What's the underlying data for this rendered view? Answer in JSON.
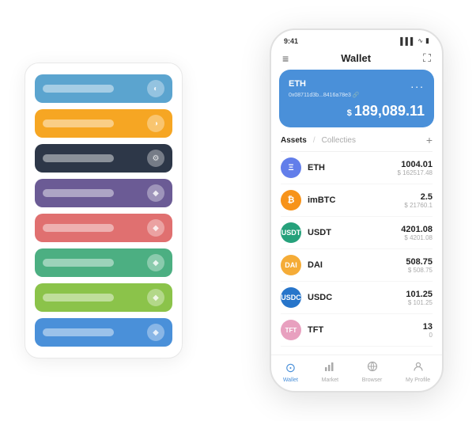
{
  "status_bar": {
    "time": "9:41",
    "signal": "▌▌▌",
    "wifi": "WiFi",
    "battery": "■"
  },
  "nav": {
    "menu_icon": "≡",
    "title": "Wallet",
    "expand_icon": "⛶"
  },
  "eth_card": {
    "label": "ETH",
    "dots": "...",
    "address": "0x08711d3b...8416a78e3 🔗",
    "currency_symbol": "$",
    "amount": "189,089.11"
  },
  "tabs": {
    "active": "Assets",
    "divider": "/",
    "inactive": "Collecties",
    "add_icon": "+"
  },
  "assets": [
    {
      "symbol": "ETH",
      "qty": "1004.01",
      "usd": "$ 162517.48",
      "color": "eth-coin",
      "icon": "Ξ"
    },
    {
      "symbol": "imBTC",
      "qty": "2.5",
      "usd": "$ 21760.1",
      "color": "imbtc-coin",
      "icon": "₿"
    },
    {
      "symbol": "USDT",
      "qty": "4201.08",
      "usd": "$ 4201.08",
      "color": "usdt-coin",
      "icon": "₮"
    },
    {
      "symbol": "DAI",
      "qty": "508.75",
      "usd": "$ 508.75",
      "color": "dai-coin",
      "icon": "◈"
    },
    {
      "symbol": "USDC",
      "qty": "101.25",
      "usd": "$ 101.25",
      "color": "usdc-coin",
      "icon": "⊙"
    },
    {
      "symbol": "TFT",
      "qty": "13",
      "usd": "0",
      "color": "tft-coin",
      "icon": "🌀"
    }
  ],
  "bottom_tabs": [
    {
      "label": "Wallet",
      "active": true,
      "icon": "⊙"
    },
    {
      "label": "Market",
      "active": false,
      "icon": "📊"
    },
    {
      "label": "Browser",
      "active": false,
      "icon": "🌐"
    },
    {
      "label": "My Profile",
      "active": false,
      "icon": "👤"
    }
  ],
  "card_stack": [
    {
      "color": "card-blue",
      "icon": "◐"
    },
    {
      "color": "card-orange",
      "icon": "◑"
    },
    {
      "color": "card-dark",
      "icon": "⚙"
    },
    {
      "color": "card-purple",
      "icon": "◆"
    },
    {
      "color": "card-red",
      "icon": "◆"
    },
    {
      "color": "card-green",
      "icon": "◆"
    },
    {
      "color": "card-light-green",
      "icon": "◆"
    },
    {
      "color": "card-blue2",
      "icon": "◆"
    }
  ]
}
